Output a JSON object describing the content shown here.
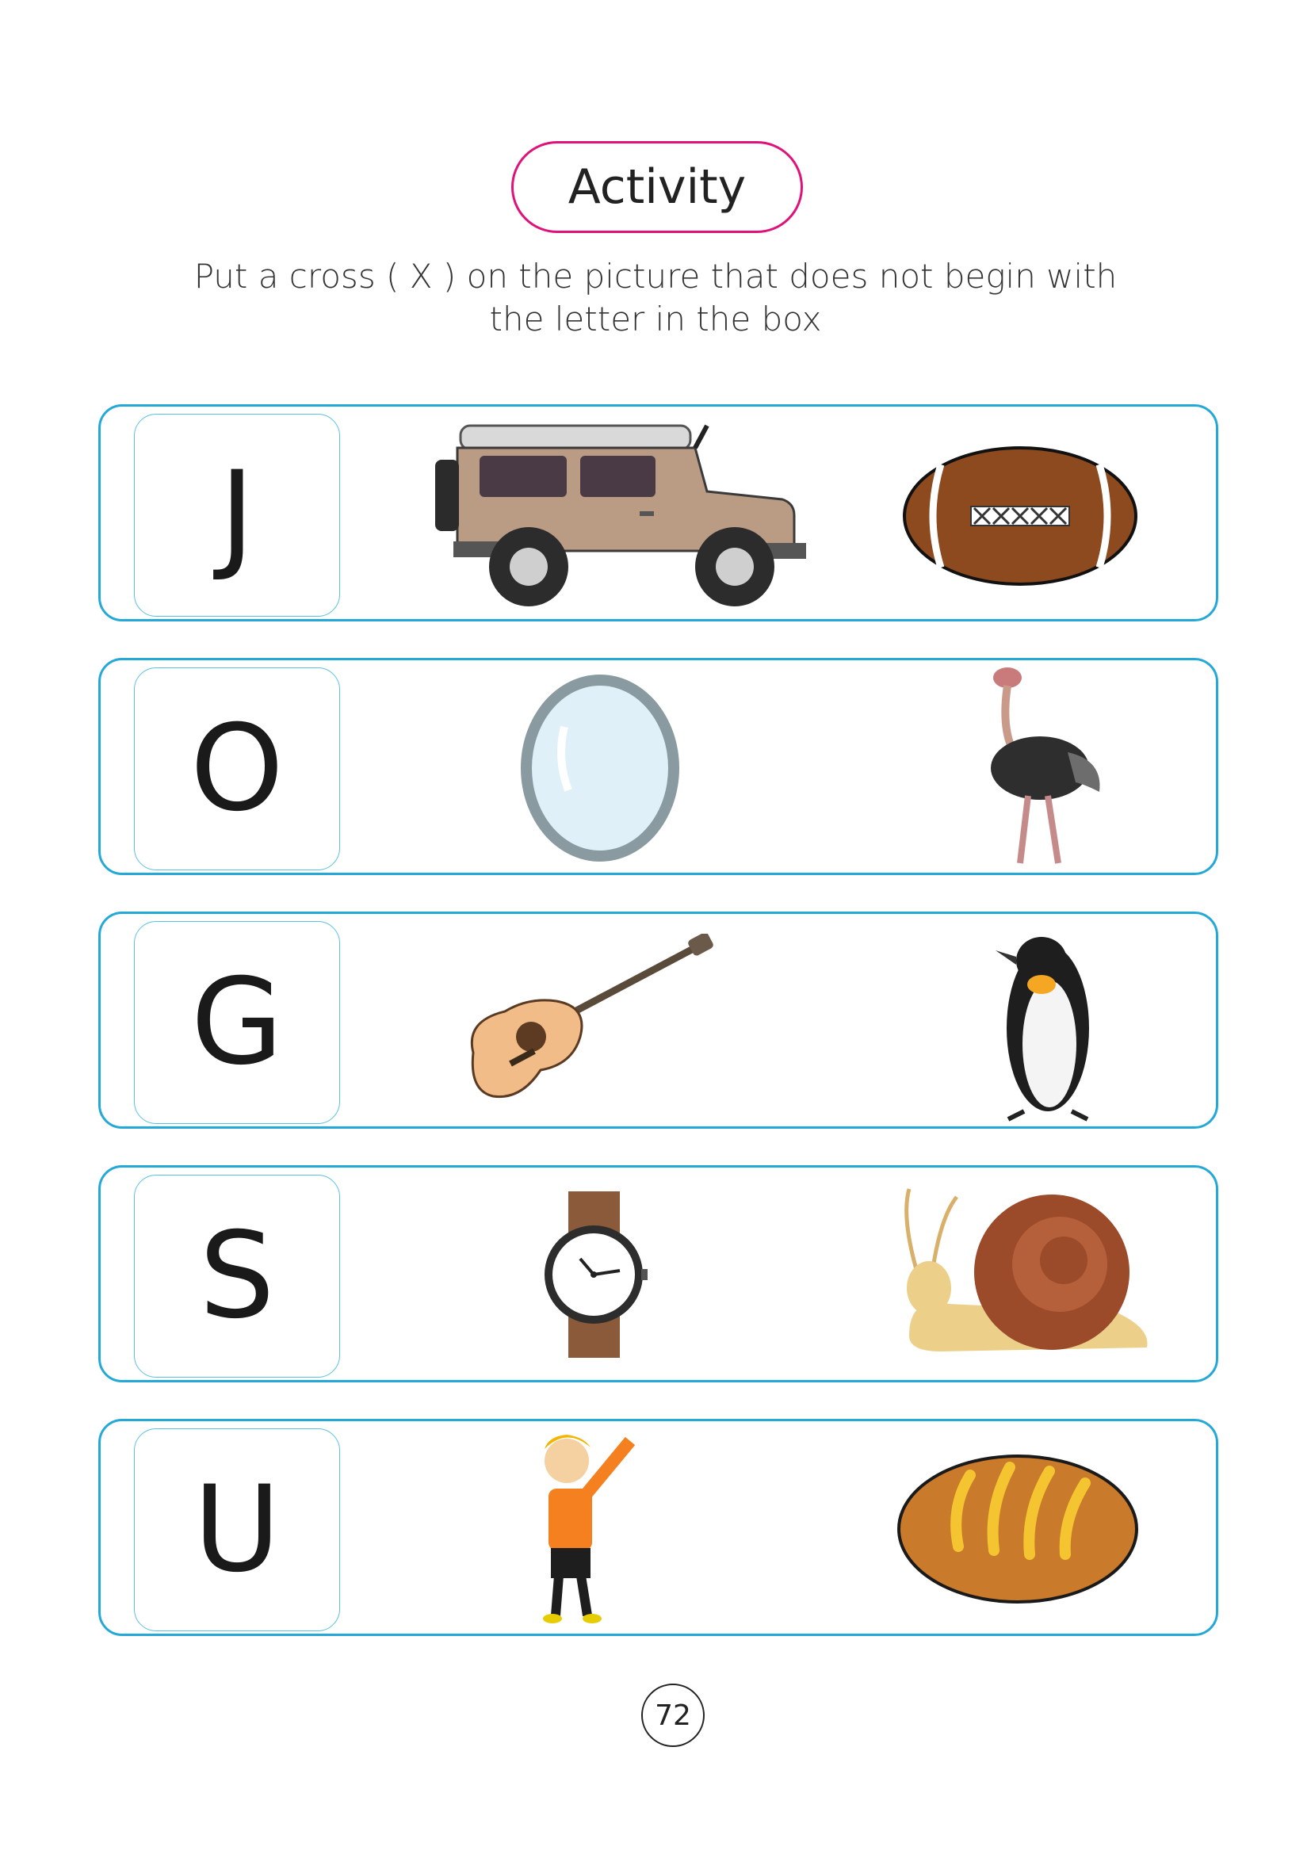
{
  "header": {
    "title": "Activity",
    "instruction_line1": "Put a cross ( X ) on the picture that does not begin with",
    "instruction_line2": "the letter in the box"
  },
  "rows": [
    {
      "letter": "J",
      "pictures": [
        "jeep-icon",
        "football-icon"
      ]
    },
    {
      "letter": "O",
      "pictures": [
        "mirror-icon",
        "ostrich-icon"
      ]
    },
    {
      "letter": "G",
      "pictures": [
        "guitar-icon",
        "penguin-icon"
      ]
    },
    {
      "letter": "S",
      "pictures": [
        "watch-icon",
        "snail-icon"
      ]
    },
    {
      "letter": "U",
      "pictures": [
        "umpire-icon",
        "bread-icon"
      ]
    }
  ],
  "footer": {
    "page_number": "72"
  },
  "colors": {
    "title_border": "#e0127a",
    "row_border": "#24a8d8",
    "letter_box_border": "#5dc0e3"
  }
}
